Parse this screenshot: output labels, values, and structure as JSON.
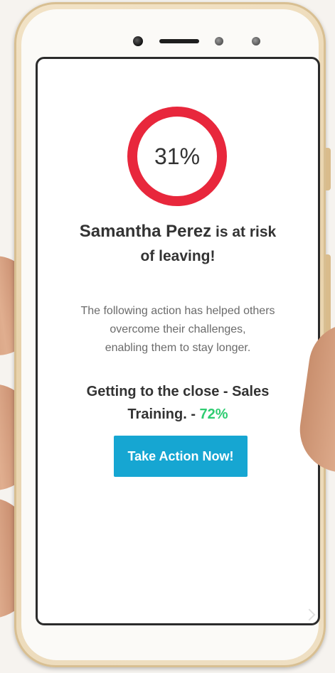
{
  "risk_meter": {
    "value_label": "31%",
    "fraction": 0.31,
    "ring_color": "#e8273c"
  },
  "headline": {
    "name": "Samantha Perez",
    "suffix_line1": "is at risk",
    "line2": "of leaving!"
  },
  "description": {
    "line1": "The following action has helped others",
    "line2": "overcome their challenges,",
    "line3": "enabling them to stay longer."
  },
  "recommended_action": {
    "line1": "Getting to the close - Sales",
    "line2_prefix": "Training. -",
    "success_rate": "72%",
    "success_color": "#2ecc71"
  },
  "cta": {
    "label": "Take Action Now!",
    "color": "#16a6d2"
  }
}
